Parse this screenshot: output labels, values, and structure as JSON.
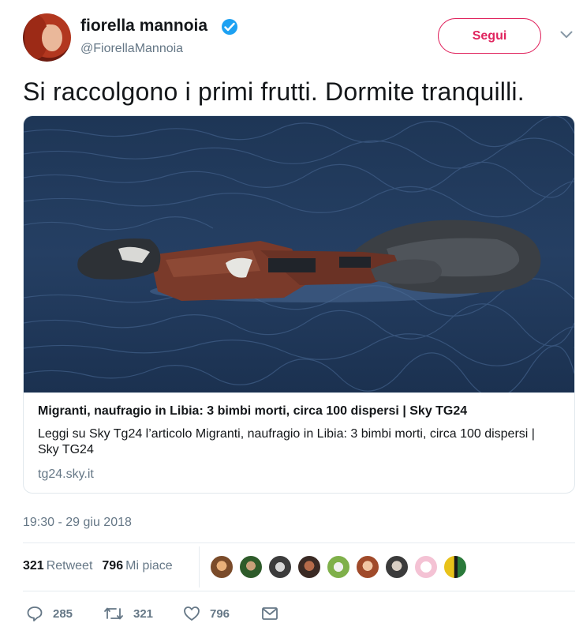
{
  "tweet": {
    "author": {
      "name": "fiorella mannoia",
      "handle": "@FiorellaMannoia",
      "verified": true
    },
    "follow_label": "Segui",
    "text": "Si raccolgono i primi frutti. Dormite tranquilli.",
    "card": {
      "title": "Migranti, naufragio in Libia: 3 bimbi morti, circa 100 dispersi | Sky TG24",
      "description": "Leggi su Sky Tg24 l’articolo Migranti, naufragio in Libia: 3 bimbi morti, circa 100 dispersi | Sky TG24",
      "domain": "tg24.sky.it"
    },
    "timestamp": "19:30 - 29 giu 2018",
    "stats": {
      "retweets": "321",
      "retweets_label": "Retweet",
      "likes": "796",
      "likes_label": "Mi piace"
    },
    "actions": {
      "replies": "285",
      "retweets": "321",
      "likes": "796"
    }
  },
  "colors": {
    "follow": "#e0245e",
    "verified": "#1da1f2",
    "secondary_text": "#657786"
  },
  "icons": [
    "verified-icon",
    "chevron-down-icon",
    "reply-icon",
    "retweet-icon",
    "like-icon",
    "direct-message-icon"
  ]
}
